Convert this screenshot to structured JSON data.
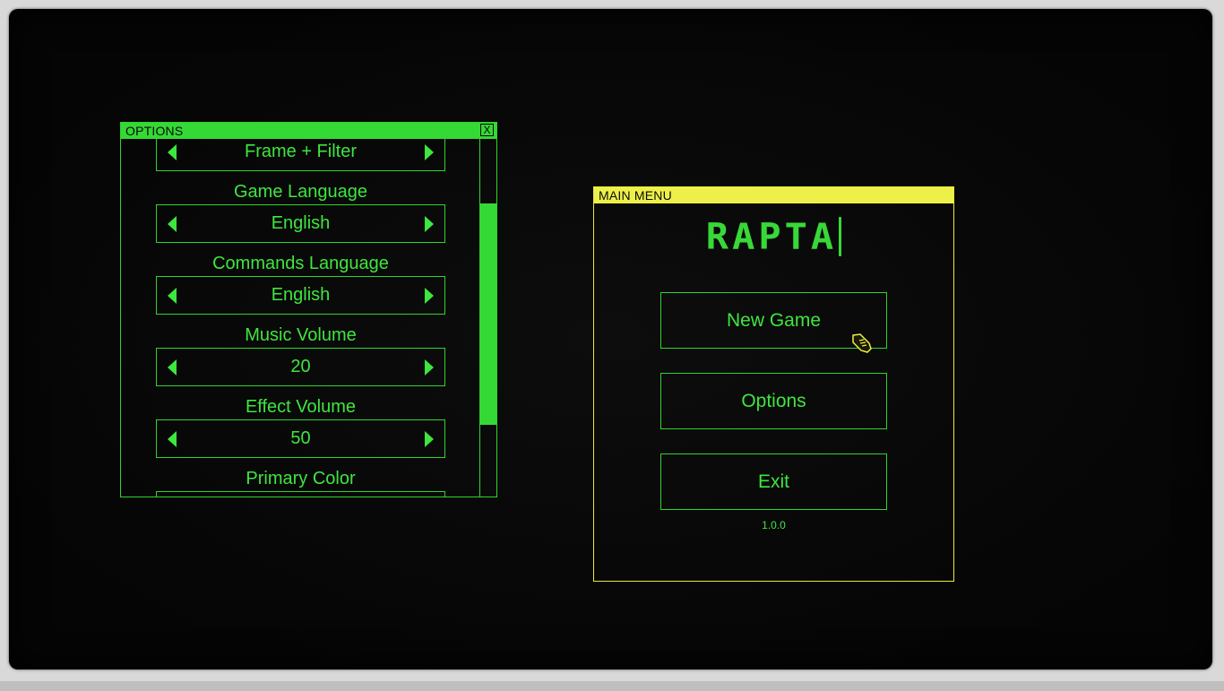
{
  "colors": {
    "primary": "#35d935",
    "menu_accent": "#eef04a",
    "background": "#060606"
  },
  "options_window": {
    "title": "OPTIONS",
    "close_label": "X",
    "rows": [
      {
        "label": "",
        "value": "Frame + Filter"
      },
      {
        "label": "Game Language",
        "value": "English"
      },
      {
        "label": "Commands Language",
        "value": "English"
      },
      {
        "label": "Music Volume",
        "value": "20"
      },
      {
        "label": "Effect Volume",
        "value": "50"
      },
      {
        "label": "Primary Color",
        "value": ""
      }
    ]
  },
  "main_menu": {
    "title": "MAIN MENU",
    "game_title": "RAPTA",
    "buttons": {
      "new_game": "New Game",
      "options": "Options",
      "exit": "Exit"
    },
    "version": "1.0.0"
  },
  "cursor": {
    "icon": "hand-cursor-icon"
  }
}
